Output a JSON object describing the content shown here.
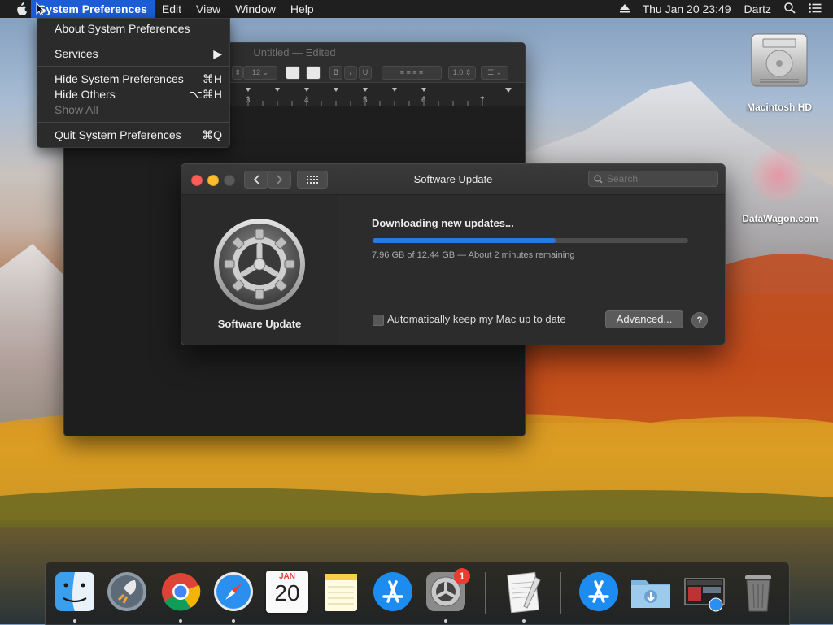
{
  "menubar": {
    "app_name": "System Preferences",
    "items": [
      "Edit",
      "View",
      "Window",
      "Help"
    ],
    "clock": "Thu Jan 20  23:49",
    "user": "Dartz"
  },
  "dropdown": {
    "about": "About System Preferences",
    "services": "Services",
    "hide": "Hide System Preferences",
    "hide_shortcut": "⌘H",
    "hide_others": "Hide Others",
    "hide_others_shortcut": "⌥⌘H",
    "show_all": "Show All",
    "quit": "Quit System Preferences",
    "quit_shortcut": "⌘Q"
  },
  "textedit": {
    "title": "Untitled",
    "edited": "Edited",
    "font_size": "12",
    "line_spacing": "1.0",
    "ruler_ticks": [
      "3",
      "4",
      "5",
      "6",
      "7"
    ]
  },
  "software_update": {
    "title": "Software Update",
    "search_placeholder": "Search",
    "heading": "Downloading new updates...",
    "progress": 0.58,
    "status": "7.96 GB of 12.44 GB — About 2 minutes remaining",
    "auto_update_label": "Automatically keep my Mac up to date",
    "advanced_button": "Advanced...",
    "help_button": "?",
    "app_label": "Software Update"
  },
  "desktop": {
    "hd_label": "Macintosh HD",
    "watermark": "DataWagon.com"
  },
  "dock": {
    "calendar_month": "JAN",
    "calendar_day": "20",
    "badge": "1"
  },
  "colors": {
    "accent": "#1c5dd6",
    "progress": "#2b78e4",
    "close": "#fc5f57",
    "minimize": "#fdbc2e"
  }
}
